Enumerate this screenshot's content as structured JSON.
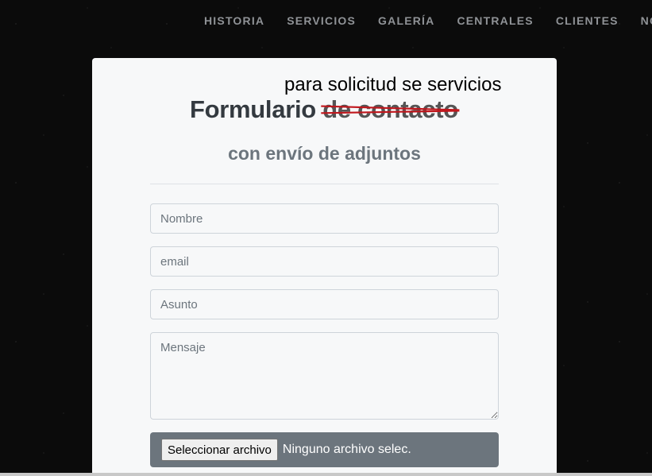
{
  "nav": {
    "items": [
      "HISTORIA",
      "SERVICIOS",
      "GALERÍA",
      "CENTRALES",
      "CLIENTES",
      "NO"
    ]
  },
  "form": {
    "annotation": "para solicitud se servicios",
    "title_main": "Formulario",
    "title_struck": "de contacto",
    "subtitle": "con envío de adjuntos",
    "fields": {
      "name_placeholder": "Nombre",
      "email_placeholder": "email",
      "subject_placeholder": "Asunto",
      "message_placeholder": "Mensaje"
    },
    "file": {
      "button_label": "Seleccionar archivo",
      "status": "Ninguno archivo selec."
    }
  },
  "colors": {
    "strike": "#c0161c",
    "nav_text": "#8f9296",
    "file_bg": "#6c757d"
  }
}
